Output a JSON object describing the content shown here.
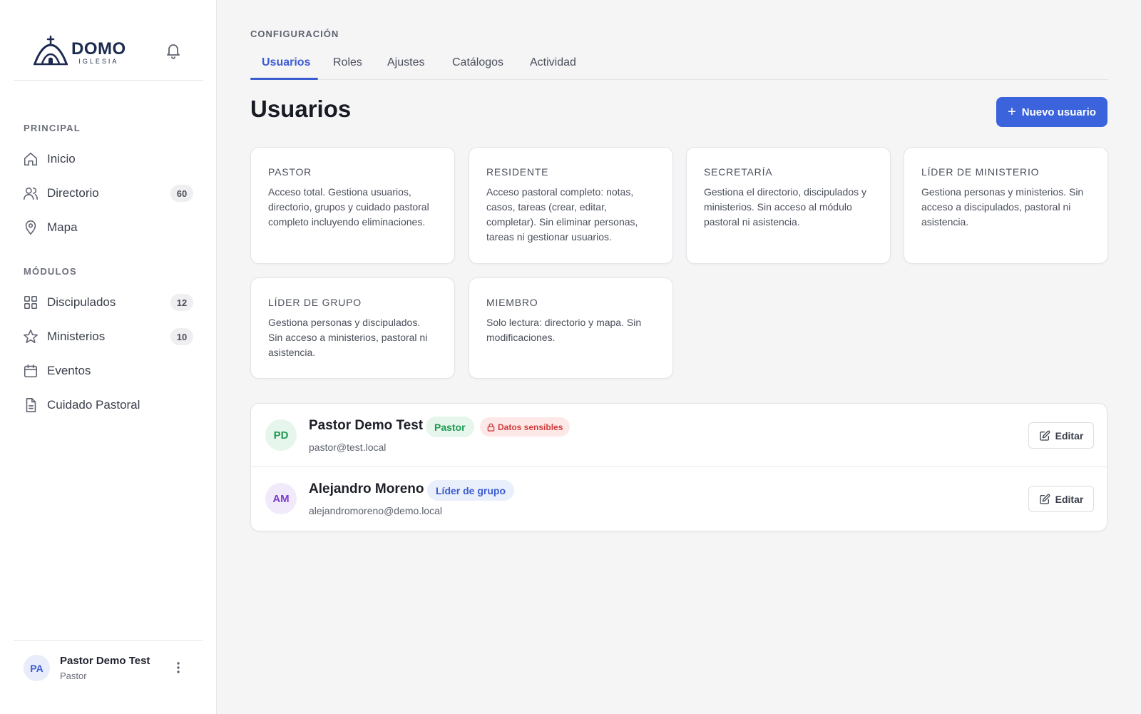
{
  "brand": {
    "name": "DOMO",
    "subtitle": "IGLESIA"
  },
  "sidebar": {
    "sections": [
      {
        "label": "PRINCIPAL"
      },
      {
        "label": "MÓDULOS"
      }
    ],
    "items": [
      {
        "label": "Inicio",
        "icon": "home-icon"
      },
      {
        "label": "Directorio",
        "icon": "users-icon",
        "count": "60"
      },
      {
        "label": "Mapa",
        "icon": "map-pin-icon"
      },
      {
        "label": "Discipulados",
        "icon": "grid-icon",
        "count": "12"
      },
      {
        "label": "Ministerios",
        "icon": "star-icon",
        "count": "10"
      },
      {
        "label": "Eventos",
        "icon": "calendar-icon"
      },
      {
        "label": "Cuidado Pastoral",
        "icon": "document-icon"
      }
    ],
    "user": {
      "initials": "PA",
      "name": "Pastor Demo Test",
      "role": "Pastor"
    }
  },
  "header": {
    "breadcrumb": "CONFIGURACIÓN",
    "tabs": [
      {
        "label": "Usuarios",
        "active": true
      },
      {
        "label": "Roles"
      },
      {
        "label": "Ajustes"
      },
      {
        "label": "Catálogos"
      },
      {
        "label": "Actividad"
      }
    ]
  },
  "page": {
    "title": "Usuarios",
    "new_button": "Nuevo usuario"
  },
  "roles": [
    {
      "title": "PASTOR",
      "description": "Acceso total. Gestiona usuarios, directorio, grupos y cuidado pastoral completo incluyendo eliminaciones."
    },
    {
      "title": "RESIDENTE",
      "description": "Acceso pastoral completo: notas, casos, tareas (crear, editar, completar). Sin eliminar personas, tareas ni gestionar usuarios."
    },
    {
      "title": "SECRETARÍA",
      "description": "Gestiona el directorio, discipulados y ministerios. Sin acceso al módulo pastoral ni asistencia."
    },
    {
      "title": "LÍDER DE MINISTERIO",
      "description": "Gestiona personas y ministerios. Sin acceso a discipulados, pastoral ni asistencia."
    },
    {
      "title": "LÍDER DE GRUPO",
      "description": "Gestiona personas y discipulados. Sin acceso a ministerios, pastoral ni asistencia."
    },
    {
      "title": "MIEMBRO",
      "description": "Solo lectura: directorio y mapa. Sin modificaciones."
    }
  ],
  "users": [
    {
      "initials": "PD",
      "name": "Pastor Demo Test",
      "email": "pastor@test.local",
      "role_badge": "Pastor",
      "sensitive_badge": "Datos sensibles",
      "edit_label": "Editar"
    },
    {
      "initials": "AM",
      "name": "Alejandro Moreno",
      "email": "alejandromoreno@demo.local",
      "role_badge": "Líder de grupo",
      "edit_label": "Editar"
    }
  ],
  "colors": {
    "accent": "#3b63db",
    "pastor_badge_bg": "#e6f6ec",
    "pastor_badge_fg": "#1f9a53",
    "sensitive_badge_bg": "#fde8e8",
    "sensitive_badge_fg": "#d13c3c",
    "leader_badge_bg": "#eaeffc",
    "leader_badge_fg": "#3b5bd0"
  }
}
